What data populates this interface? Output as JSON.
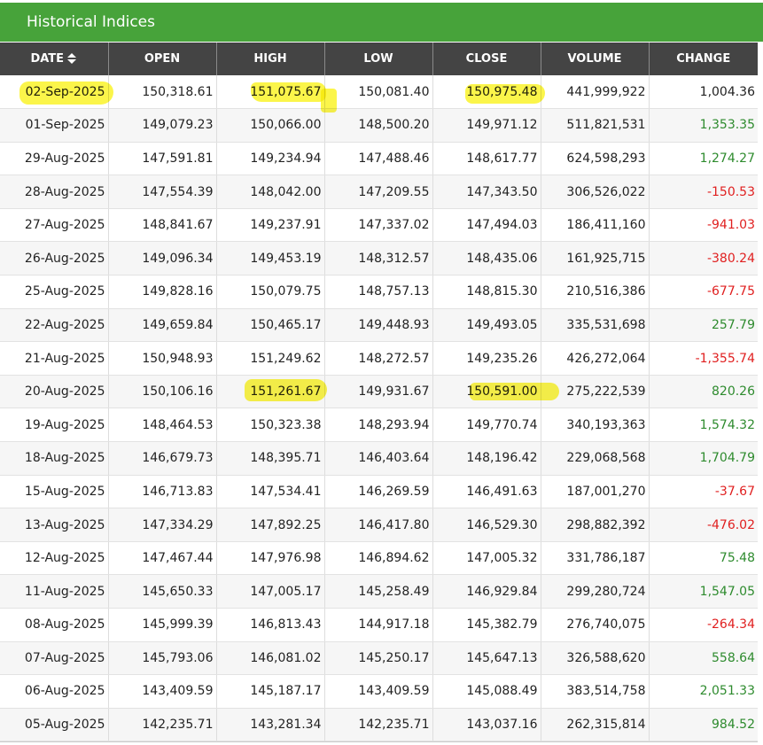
{
  "panel": {
    "title": "Historical Indices"
  },
  "table": {
    "headers": [
      "DATE",
      "OPEN",
      "HIGH",
      "LOW",
      "CLOSE",
      "VOLUME",
      "CHANGE"
    ],
    "sort_icon": "sort-up-down-icon",
    "rows": [
      [
        "02-Sep-2025",
        "150,318.61",
        "151,075.67",
        "150,081.40",
        "150,975.48",
        "441,999,922",
        "1,004.36"
      ],
      [
        "01-Sep-2025",
        "149,079.23",
        "150,066.00",
        "148,500.20",
        "149,971.12",
        "511,821,531",
        "1,353.35"
      ],
      [
        "29-Aug-2025",
        "147,591.81",
        "149,234.94",
        "147,488.46",
        "148,617.77",
        "624,598,293",
        "1,274.27"
      ],
      [
        "28-Aug-2025",
        "147,554.39",
        "148,042.00",
        "147,209.55",
        "147,343.50",
        "306,526,022",
        "-150.53"
      ],
      [
        "27-Aug-2025",
        "148,841.67",
        "149,237.91",
        "147,337.02",
        "147,494.03",
        "186,411,160",
        "-941.03"
      ],
      [
        "26-Aug-2025",
        "149,096.34",
        "149,453.19",
        "148,312.57",
        "148,435.06",
        "161,925,715",
        "-380.24"
      ],
      [
        "25-Aug-2025",
        "149,828.16",
        "150,079.75",
        "148,757.13",
        "148,815.30",
        "210,516,386",
        "-677.75"
      ],
      [
        "22-Aug-2025",
        "149,659.84",
        "150,465.17",
        "149,448.93",
        "149,493.05",
        "335,531,698",
        "257.79"
      ],
      [
        "21-Aug-2025",
        "150,948.93",
        "151,249.62",
        "148,272.57",
        "149,235.26",
        "426,272,064",
        "-1,355.74"
      ],
      [
        "20-Aug-2025",
        "150,106.16",
        "151,261.67",
        "149,931.67",
        "150,591.00",
        "275,222,539",
        "820.26"
      ],
      [
        "19-Aug-2025",
        "148,464.53",
        "150,323.38",
        "148,293.94",
        "149,770.74",
        "340,193,363",
        "1,574.32"
      ],
      [
        "18-Aug-2025",
        "146,679.73",
        "148,395.71",
        "146,403.64",
        "148,196.42",
        "229,068,568",
        "1,704.79"
      ],
      [
        "15-Aug-2025",
        "146,713.83",
        "147,534.41",
        "146,269.59",
        "146,491.63",
        "187,001,270",
        "-37.67"
      ],
      [
        "13-Aug-2025",
        "147,334.29",
        "147,892.25",
        "146,417.80",
        "146,529.30",
        "298,882,392",
        "-476.02"
      ],
      [
        "12-Aug-2025",
        "147,467.44",
        "147,976.98",
        "146,894.62",
        "147,005.32",
        "331,786,187",
        "75.48"
      ],
      [
        "11-Aug-2025",
        "145,650.33",
        "147,005.17",
        "145,258.49",
        "146,929.84",
        "299,280,724",
        "1,547.05"
      ],
      [
        "08-Aug-2025",
        "145,999.39",
        "146,813.43",
        "144,917.18",
        "145,382.79",
        "276,740,075",
        "-264.34"
      ],
      [
        "07-Aug-2025",
        "145,793.06",
        "146,081.02",
        "145,250.17",
        "145,647.13",
        "326,588,620",
        "558.64"
      ],
      [
        "06-Aug-2025",
        "143,409.59",
        "145,187.17",
        "143,409.59",
        "145,088.49",
        "383,514,758",
        "2,051.33"
      ],
      [
        "05-Aug-2025",
        "142,235.71",
        "143,281.34",
        "142,235.71",
        "143,037.16",
        "262,315,814",
        "984.52"
      ]
    ]
  },
  "colors": {
    "title_bar": "#47a33a",
    "header_bg": "#444444",
    "positive": "#2e8b2e",
    "negative": "#e02020",
    "highlight": "#fbf42a"
  }
}
